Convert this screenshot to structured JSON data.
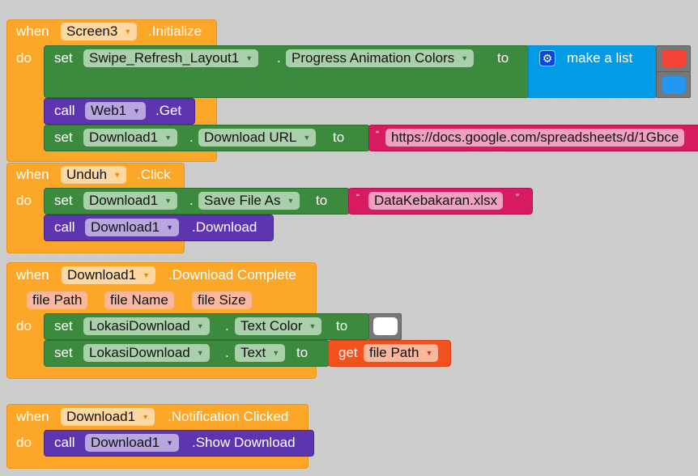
{
  "blocks": [
    {
      "when": "when",
      "component": "Screen3",
      "event": ".Initialize",
      "do": "do",
      "set1": {
        "kw": "set",
        "component": "Swipe_Refresh_Layout1",
        "dot": ".",
        "property": "Progress Animation Colors",
        "to": "to",
        "list_label": "make a list",
        "list_icon": "gear-icon",
        "colors": [
          "#f44336",
          "#2196f3"
        ]
      },
      "call1": {
        "kw": "call",
        "component": "Web1",
        "method": ".Get"
      },
      "set2": {
        "kw": "set",
        "component": "Download1",
        "dot": ".",
        "property": "Download URL",
        "to": "to",
        "quote": "“",
        "text": "https://docs.google.com/spreadsheets/d/1Gbce"
      }
    },
    {
      "when": "when",
      "component": "Unduh",
      "event": ".Click",
      "do": "do",
      "set1": {
        "kw": "set",
        "component": "Download1",
        "dot": ".",
        "property": "Save File As",
        "to": "to",
        "quote_open": "“",
        "text": "DataKebakaran.xlsx",
        "quote_close": "”"
      },
      "call1": {
        "kw": "call",
        "component": "Download1",
        "method": ".Download"
      }
    },
    {
      "when": "when",
      "component": "Download1",
      "event": ".Download Complete",
      "do": "do",
      "params": [
        "file Path",
        "file Name",
        "file Size"
      ],
      "set1": {
        "kw": "set",
        "component": "LokasiDownload",
        "dot": ".",
        "property": "Text Color",
        "to": "to",
        "color": "#ffffff"
      },
      "set2": {
        "kw": "set",
        "component": "LokasiDownload",
        "dot": ".",
        "property": "Text",
        "to": "to",
        "get": "get",
        "var": "file Path"
      }
    },
    {
      "when": "when",
      "component": "Download1",
      "event": ".Notification Clicked",
      "do": "do",
      "call1": {
        "kw": "call",
        "component": "Download1",
        "method": ".Show Download"
      }
    }
  ]
}
